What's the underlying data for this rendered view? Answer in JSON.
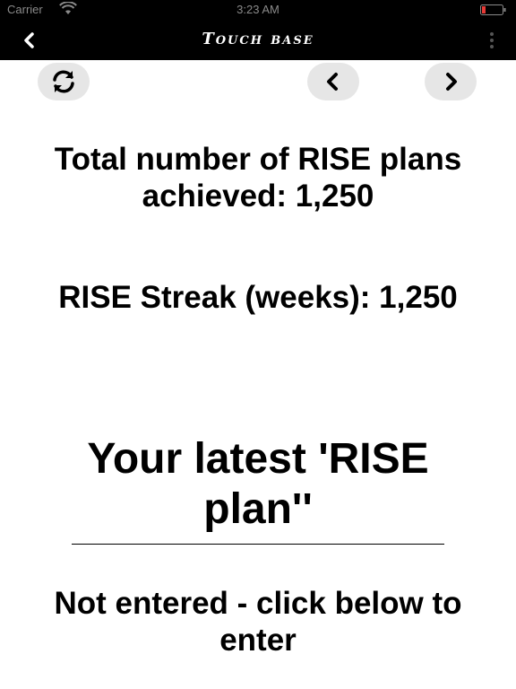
{
  "status_bar": {
    "carrier": "Carrier",
    "time": "3:23 AM",
    "icons": [
      "wifi-icon",
      "battery-icon"
    ]
  },
  "nav": {
    "title": "Touch base",
    "back_icon": "chevron-left-icon",
    "menu_icon": "vertical-dots-icon"
  },
  "controls": {
    "refresh_icon": "refresh-icon",
    "prev_icon": "chevron-left-icon",
    "next_icon": "chevron-right-icon"
  },
  "stats": {
    "total_plans": "Total number of RISE plans achieved: 1,250",
    "streak": "RISE Streak (weeks): 1,250"
  },
  "latest": {
    "heading": "Your latest 'RISE plan''",
    "status": "Not entered - click below to enter"
  },
  "colors": {
    "bar_background": "#000000",
    "button_background": "#e6e6e6",
    "battery_low": "#e53935"
  }
}
